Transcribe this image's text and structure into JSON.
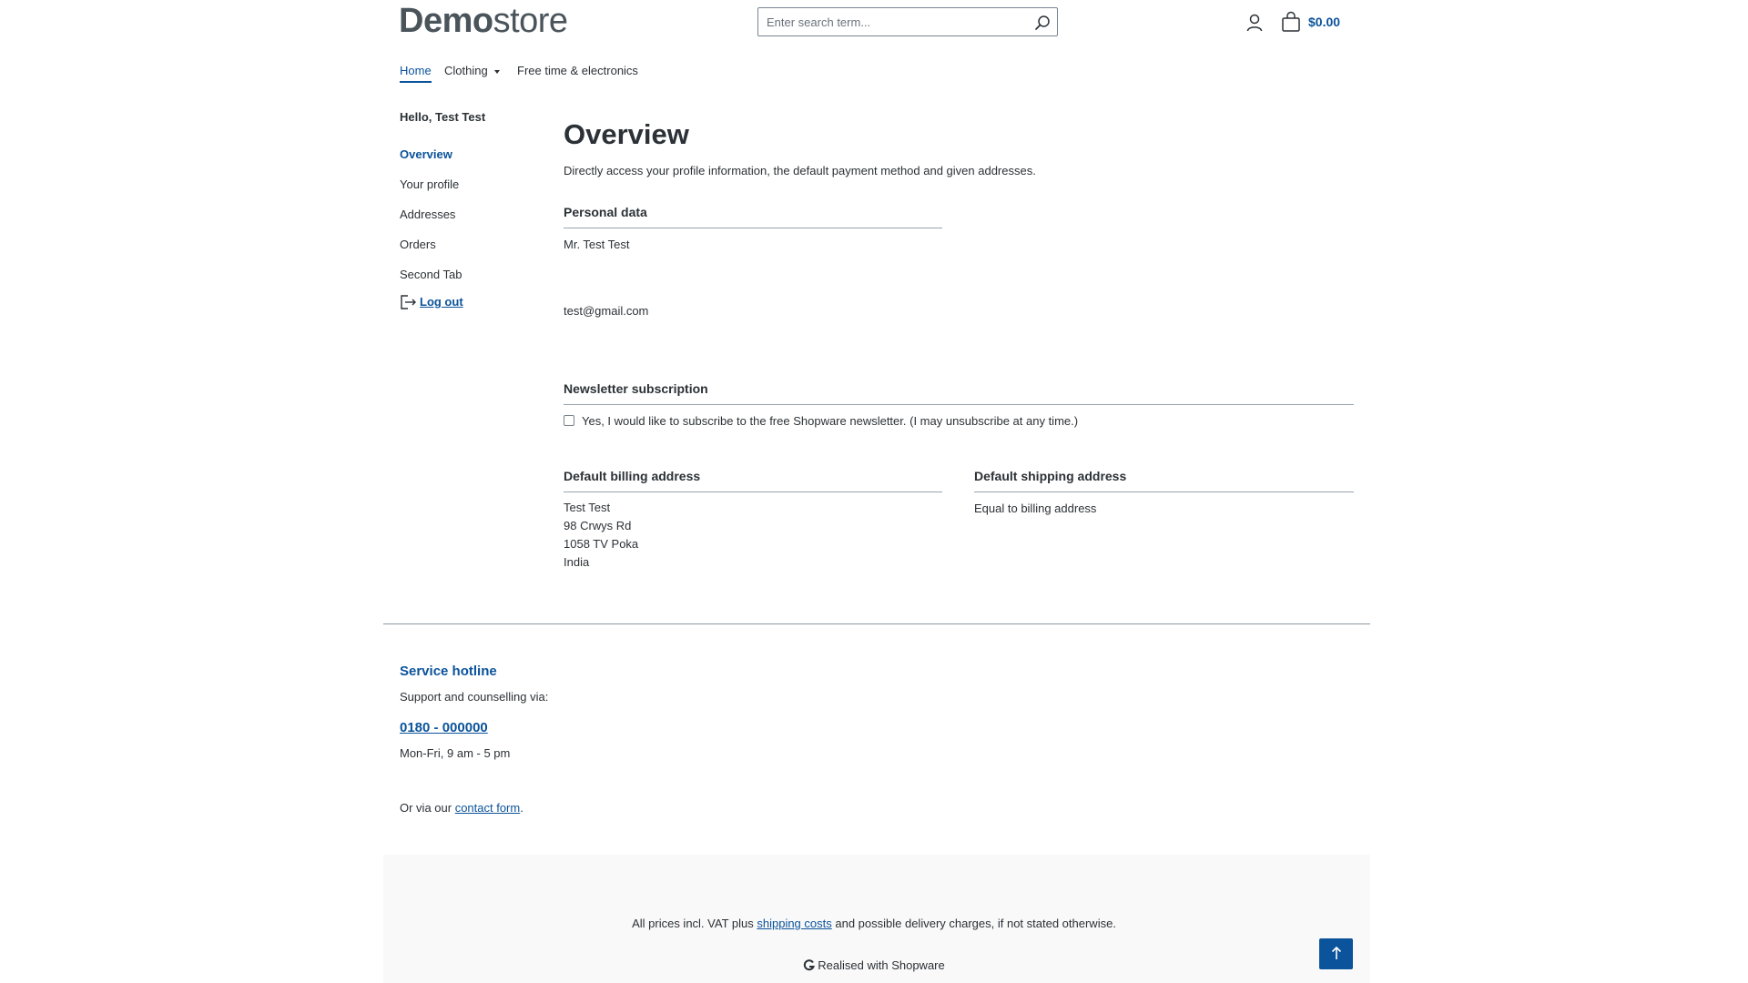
{
  "header": {
    "logo_bold": "Demo",
    "logo_light": "store",
    "search_placeholder": "Enter search term...",
    "cart_total": "$0.00"
  },
  "nav": {
    "items": [
      {
        "label": "Home",
        "active": true
      },
      {
        "label": "Clothing",
        "has_dropdown": true
      },
      {
        "label": "Free time & electronics"
      }
    ]
  },
  "sidebar": {
    "greeting": "Hello, Test Test",
    "items": [
      {
        "label": "Overview",
        "active": true
      },
      {
        "label": "Your profile"
      },
      {
        "label": "Addresses"
      },
      {
        "label": "Orders"
      },
      {
        "label": "Second Tab"
      }
    ],
    "logout_label": "Log out"
  },
  "main": {
    "title": "Overview",
    "description": "Directly access your profile information, the default payment method and given addresses.",
    "personal_data": {
      "heading": "Personal data",
      "name": "Mr. Test Test",
      "email": "test@gmail.com"
    },
    "newsletter": {
      "heading": "Newsletter subscription",
      "checkbox_label": "Yes, I would like to subscribe to the free Shopware newsletter. (I may unsubscribe at any time.)",
      "checked": false
    },
    "billing": {
      "heading": "Default billing address",
      "lines": [
        "Test Test",
        "98 Crwys Rd",
        "1058 TV Poka",
        "India"
      ]
    },
    "shipping": {
      "heading": "Default shipping address",
      "text": "Equal to billing address"
    }
  },
  "footer": {
    "hotline_title": "Service hotline",
    "support_text": "Support and counselling via:",
    "phone": "0180 - 000000",
    "hours": "Mon-Fri, 9 am - 5 pm",
    "contact_prefix": "Or via our ",
    "contact_link": "contact form",
    "contact_suffix": ".",
    "vat_prefix": "All prices incl. VAT plus ",
    "vat_link": "shipping costs",
    "vat_suffix": " and possible delivery charges, if not stated otherwise.",
    "realised": "Realised with Shopware"
  },
  "colors": {
    "accent": "#0b539b",
    "text": "#2b3136",
    "footer_bg": "#f9f9f9"
  }
}
